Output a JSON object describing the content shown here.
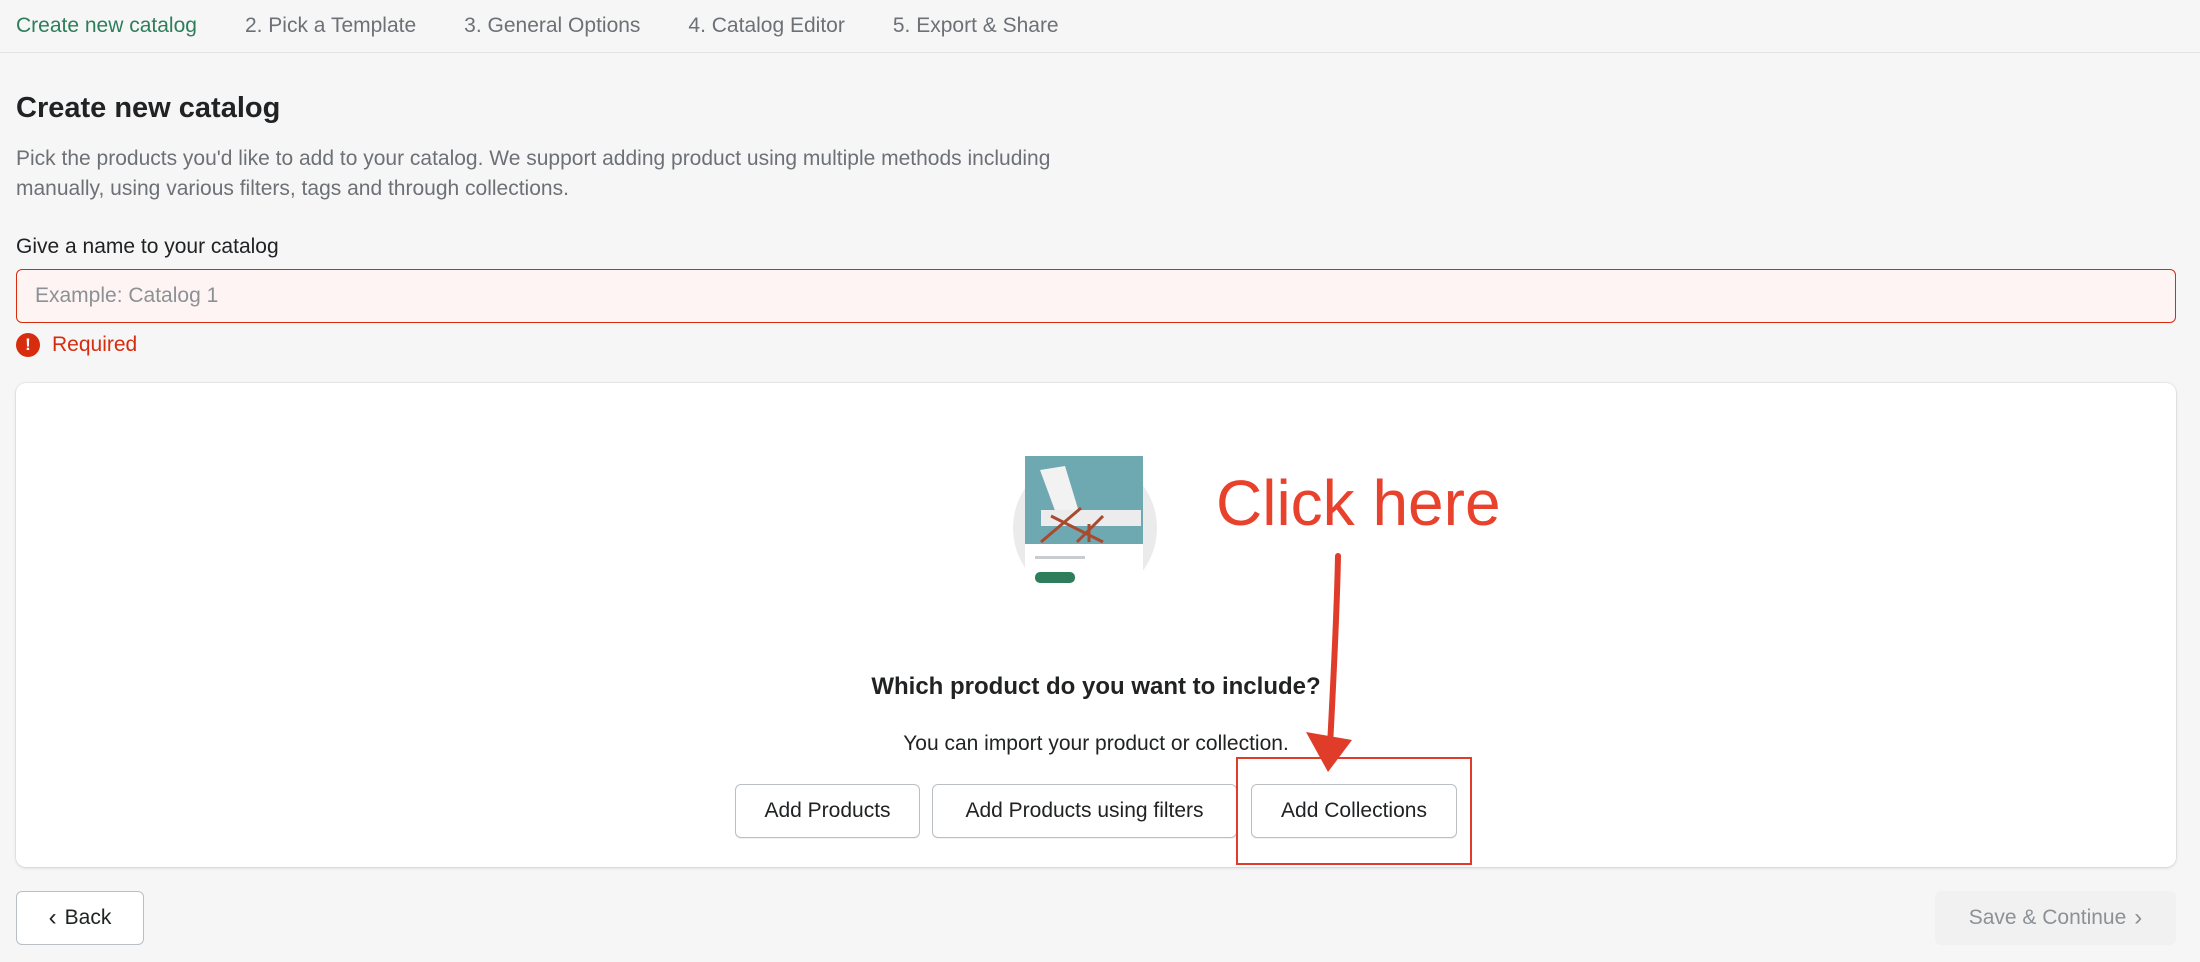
{
  "stepper": {
    "steps": [
      {
        "label": "Create new catalog",
        "active": true
      },
      {
        "label": "2. Pick a Template",
        "active": false
      },
      {
        "label": "3. General Options",
        "active": false
      },
      {
        "label": "4. Catalog Editor",
        "active": false
      },
      {
        "label": "5. Export & Share",
        "active": false
      }
    ]
  },
  "header": {
    "title": "Create new catalog",
    "description": "Pick the products you'd like to add to your catalog. We support adding product using multiple methods including manually, using various filters, tags and through collections."
  },
  "name_field": {
    "label": "Give a name to your catalog",
    "placeholder": "Example: Catalog 1",
    "value": "",
    "error": "Required",
    "error_icon": "!"
  },
  "card": {
    "heading": "Which product do you want to include?",
    "subtext": "You can import your product or collection.",
    "buttons": {
      "add_products": "Add Products",
      "add_products_filters": "Add Products using filters",
      "add_collections": "Add Collections"
    }
  },
  "annotation": {
    "text": "Click here",
    "color": "#e8412c"
  },
  "footer": {
    "back_label": "Back",
    "save_label": "Save & Continue",
    "back_icon": "‹",
    "save_icon": "›"
  },
  "colors": {
    "accent_green": "#2e7d5b",
    "error_red": "#d72c0d",
    "background": "#f6f6f7"
  }
}
